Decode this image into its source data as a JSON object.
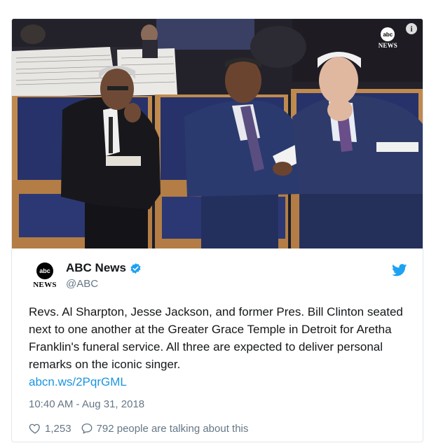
{
  "media": {
    "watermark_logo": "abc",
    "watermark_text": "NEWS",
    "info_icon": "i"
  },
  "account": {
    "avatar_logo": "abc",
    "avatar_text": "NEWS",
    "display_name": "ABC News",
    "handle": "@ABC",
    "verified": true
  },
  "tweet": {
    "text": "Revs. Al Sharpton, Jesse Jackson, and former Pres. Bill Clinton seated next to one another at the Greater Grace Temple in Detroit for Aretha Franklin's funeral service. All three are expected to deliver personal remarks on the iconic singer.",
    "link": "abcn.ws/2PqrGML",
    "timestamp": "10:40 AM - Aug 31, 2018"
  },
  "actions": {
    "likes": "1,253",
    "talking": "792 people are talking about this"
  },
  "colors": {
    "twitter_blue": "#1da1f2",
    "link_blue": "#1b95e0",
    "chair_blue": "#27326a",
    "chair_wood": "#c08a4e"
  },
  "icons": [
    "info-icon",
    "verified-badge-icon",
    "twitter-bird-icon",
    "heart-icon",
    "speech-bubble-icon"
  ]
}
